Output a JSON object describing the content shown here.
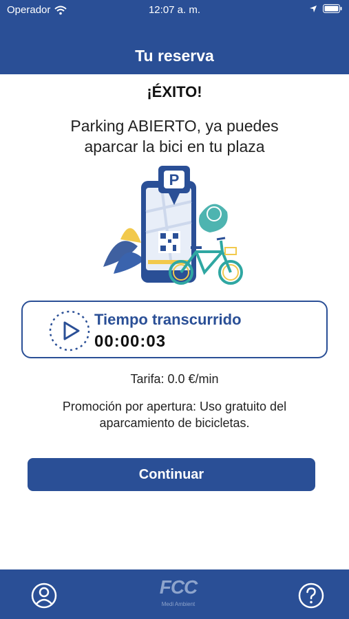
{
  "status_bar": {
    "carrier": "Operador",
    "time": "12:07 a. m."
  },
  "header": {
    "title": "Tu reserva"
  },
  "main": {
    "success": "¡ÉXITO!",
    "message_line1": "Parking ABIERTO, ya puedes",
    "message_line2": "aparcar la bici en tu plaza",
    "timer": {
      "label": "Tiempo transcurrido",
      "value": "00:00:03"
    },
    "tariff": "Tarifa: 0.0 €/min",
    "promo_line1": "Promoción por apertura: Uso gratuito del",
    "promo_line2": "aparcamiento de bicicletas.",
    "continue_label": "Continuar"
  },
  "tabbar": {
    "logo_text": "FCC",
    "logo_subtext": "Medi Ambient",
    "icons": [
      "user-icon",
      "help-icon"
    ]
  },
  "colors": {
    "primary": "#2a4f96",
    "accent_teal": "#2fa7a2",
    "accent_yellow": "#f2c94c"
  }
}
